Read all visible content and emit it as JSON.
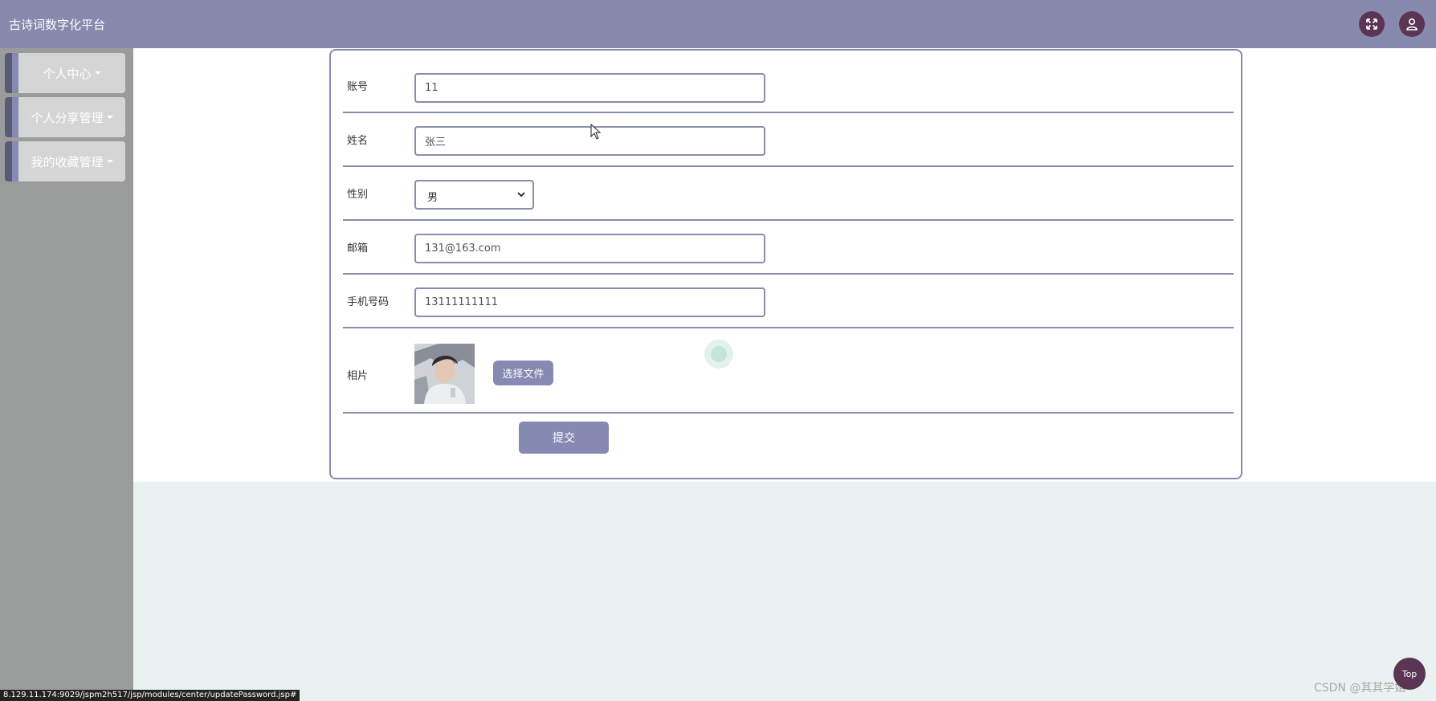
{
  "header": {
    "title": "古诗词数字化平台",
    "fullscreen_icon": "fullscreen-icon",
    "user_icon": "user-icon"
  },
  "sidebar": {
    "items": [
      {
        "label": "个人中心"
      },
      {
        "label": "个人分享管理"
      },
      {
        "label": "我的收藏管理"
      }
    ]
  },
  "form": {
    "account": {
      "label": "账号",
      "value": "11"
    },
    "name": {
      "label": "姓名",
      "value": "张三"
    },
    "gender": {
      "label": "性别",
      "value": "男"
    },
    "email": {
      "label": "邮箱",
      "value": "131@163.com"
    },
    "phone": {
      "label": "手机号码",
      "value": "13111111111"
    },
    "photo": {
      "label": "相片",
      "button": "选择文件"
    },
    "submit": "提交"
  },
  "status_bar": {
    "url": "8.129.11.174:9029/jspm2h517/jsp/modules/center/updatePassword.jsp#"
  },
  "top_button": "Top",
  "watermark": "CSDN @其其学姐",
  "colors": {
    "accent": "#8689b1",
    "dark_icon": "#5b3554",
    "sidebar": "#9a9c9b"
  }
}
